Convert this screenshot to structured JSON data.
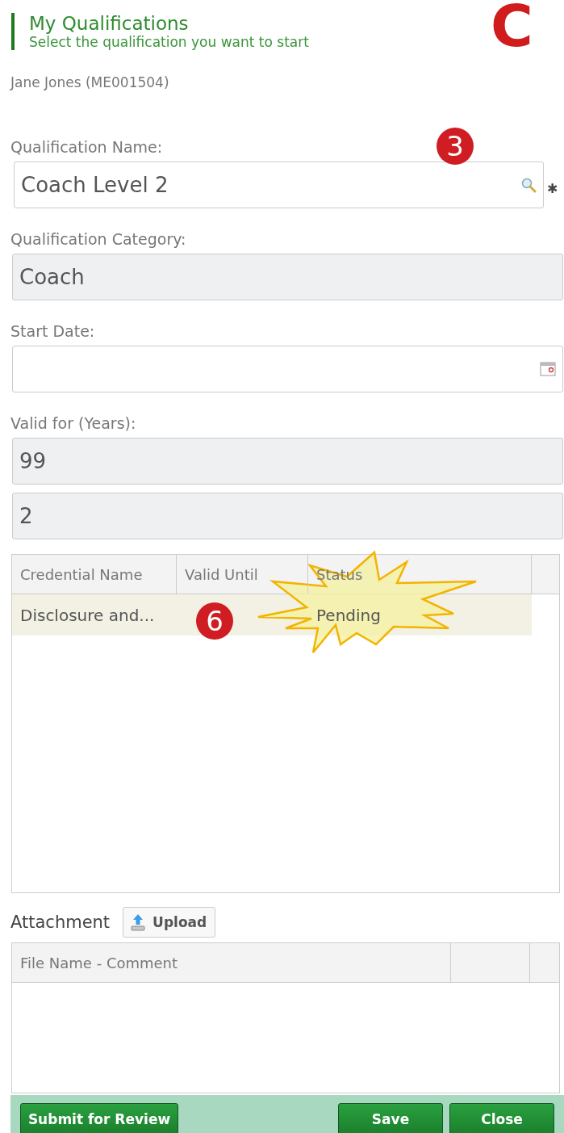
{
  "header": {
    "title": "My Qualifications",
    "subtitle": "Select the qualification you want to start"
  },
  "member": "Jane Jones (ME001504)",
  "required_mark": "✱",
  "fields": [
    {
      "label": "Qualification Name:",
      "kind": "search",
      "value": "Coach Level 2",
      "required": true
    },
    {
      "label": "Qualification Category:",
      "kind": "readonly",
      "value": "Coach",
      "required": false
    },
    {
      "label": "Start Date:",
      "kind": "date",
      "required": false
    },
    {
      "label": "Valid for (Years):",
      "kind": "readonly",
      "value": "99",
      "required": false
    },
    {
      "kind": "readonly",
      "value": "2",
      "required": false
    }
  ],
  "credentials": {
    "columns": [
      "Credential Name",
      "Valid Until",
      "Status"
    ],
    "rows": [
      {
        "cells": [
          "Disclosure and...",
          "",
          "Pending"
        ],
        "selected": true
      }
    ]
  },
  "attachment": {
    "label": "Attachment",
    "upload_button": "Upload",
    "columns": [
      "File Name - Comment"
    ]
  },
  "footer": {
    "buttons": [
      {
        "label": "Submit for Review",
        "kind": "left"
      },
      {
        "label": "Save",
        "kind": "right"
      },
      {
        "label": "Close",
        "kind": "right"
      }
    ]
  },
  "annotations": [
    {
      "kind": "title",
      "text": "C"
    },
    {
      "kind": "badge",
      "text": "3"
    },
    {
      "kind": "badge",
      "text": "6"
    },
    {
      "kind": "starburst"
    }
  ]
}
